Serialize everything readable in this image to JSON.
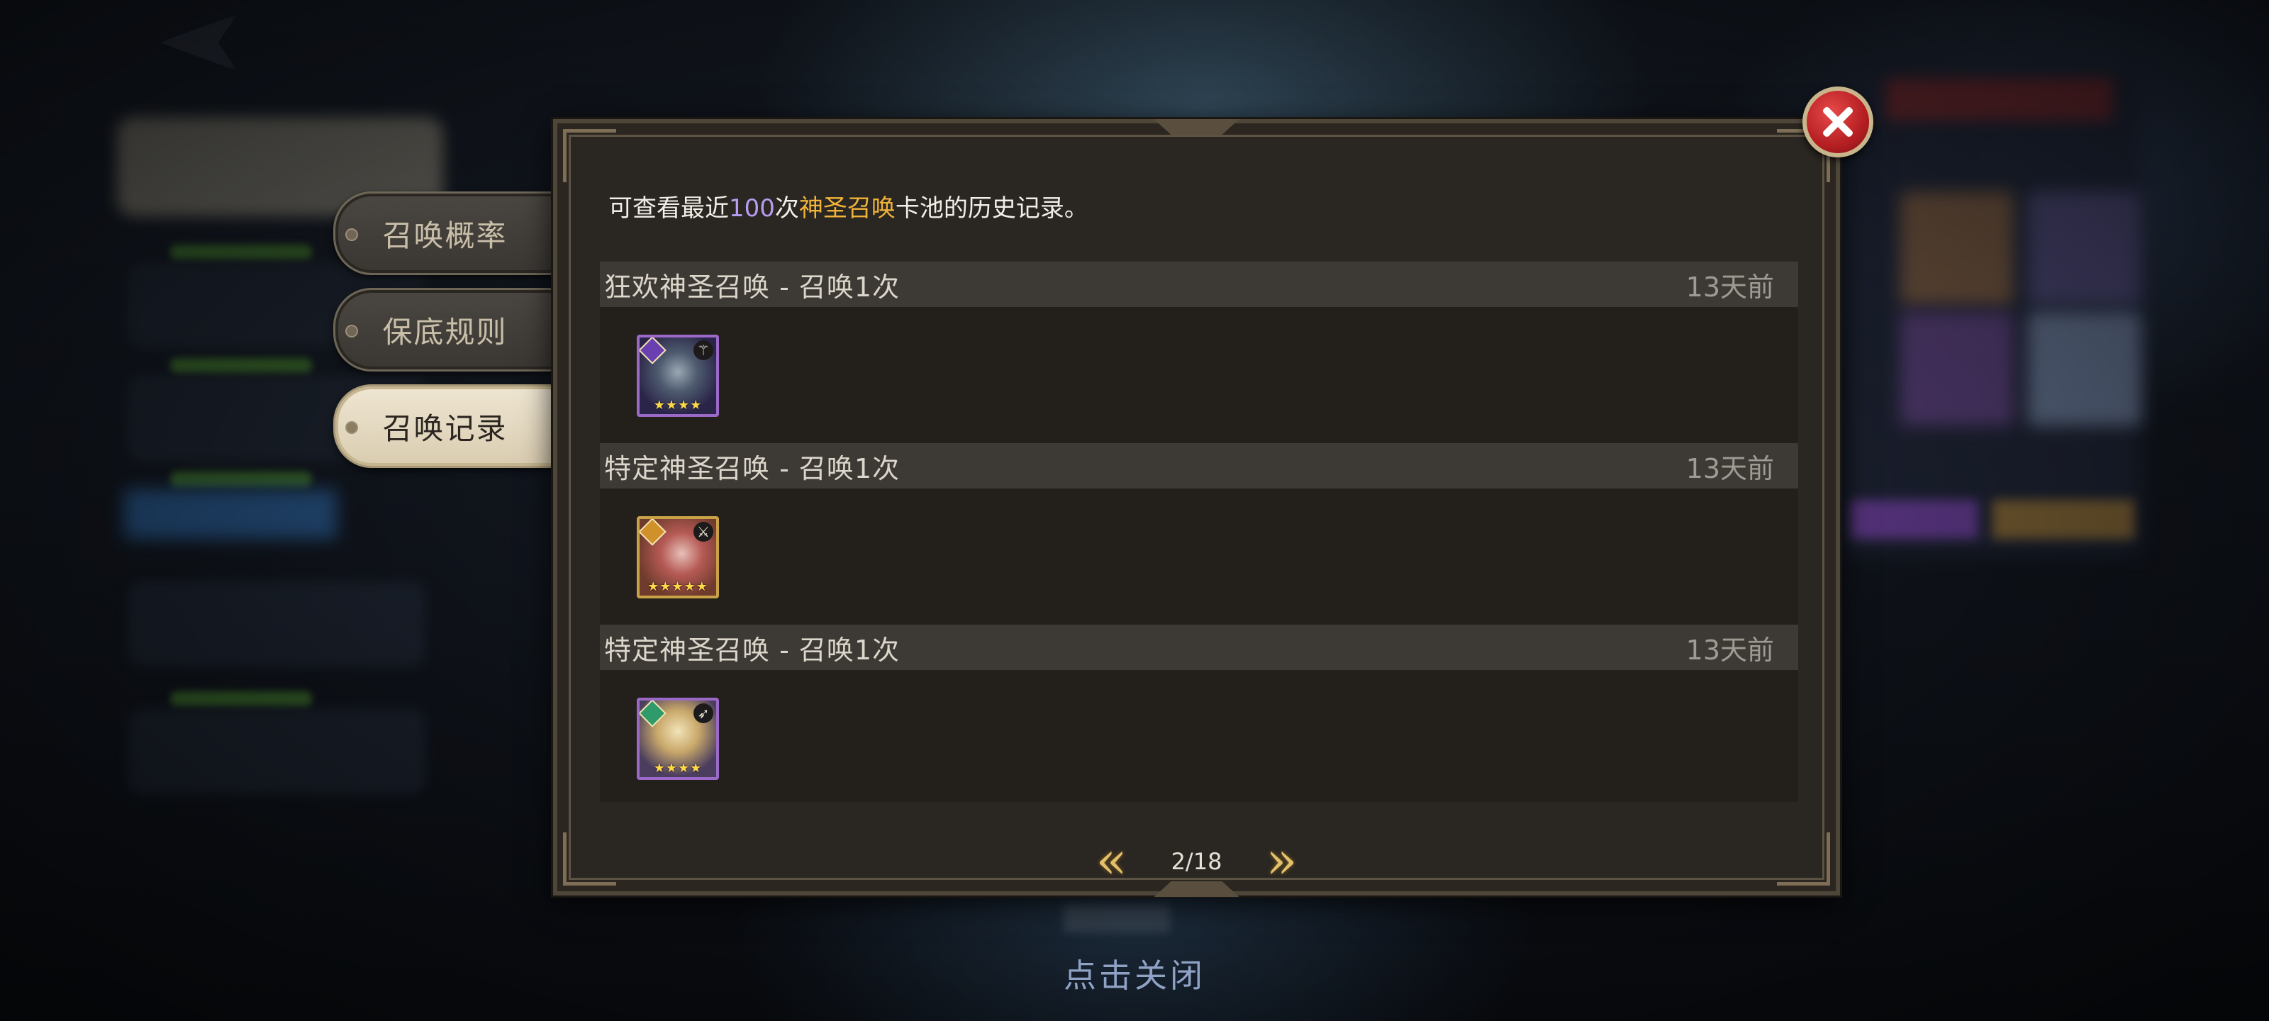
{
  "side_tabs": [
    {
      "label": "召唤概率",
      "active": false
    },
    {
      "label": "保底规则",
      "active": false
    },
    {
      "label": "召唤记录",
      "active": true
    }
  ],
  "dialog": {
    "info": {
      "prefix": "可查看最近",
      "count": "100",
      "mid": "次",
      "pool": "神圣召唤",
      "suffix": "卡池的历史记录。"
    },
    "records": [
      {
        "title": "狂欢神圣召唤 - 召唤1次",
        "time": "13天前",
        "hero": {
          "frame": "purple",
          "stars": 4,
          "class_icon": "staff-icon"
        }
      },
      {
        "title": "特定神圣召唤 - 召唤1次",
        "time": "13天前",
        "hero": {
          "frame": "gold",
          "stars": 5,
          "class_icon": "sword-icon"
        }
      },
      {
        "title": "特定神圣召唤 - 召唤1次",
        "time": "13天前",
        "hero": {
          "frame": "purple",
          "stars": 4,
          "class_icon": "bow-icon"
        }
      }
    ],
    "pager": {
      "page_text": "2/18",
      "current_page": 2,
      "total_pages": 18
    }
  },
  "tap_to_close": "点击关闭",
  "colors": {
    "count_highlight": "#b79cf0",
    "pool_highlight": "#f0b33a",
    "close_red": "#c4262a"
  }
}
